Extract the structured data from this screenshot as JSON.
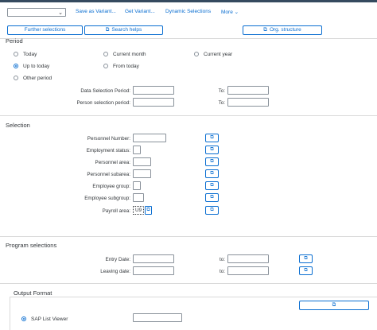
{
  "toolbar": {
    "variant_value": "",
    "save_as_variant": "Save as Variant...",
    "get_variant": "Get Variant...",
    "dynamic_selections": "Dynamic Selections",
    "more": "More"
  },
  "buttons": {
    "further_selections": "Further selections",
    "search_helps": "Search helps",
    "org_structure": "Org. structure"
  },
  "period": {
    "title": "Period",
    "options": [
      "Today",
      "Current month",
      "Current year",
      "Up to today",
      "From today",
      "Other period"
    ],
    "selected": "Up to today",
    "data_selection_label": "Data Selection Period:",
    "person_selection_label": "Person selection period:",
    "to_label": "To:"
  },
  "selection": {
    "title": "Selection",
    "fields": [
      {
        "label": "Personnel Number:",
        "value": ""
      },
      {
        "label": "Employment status:",
        "value": ""
      },
      {
        "label": "Personnel area:",
        "value": ""
      },
      {
        "label": "Personnel subarea:",
        "value": ""
      },
      {
        "label": "Employee group:",
        "value": ""
      },
      {
        "label": "Employee subgroup:",
        "value": ""
      },
      {
        "label": "Payroll area:",
        "value": "U9"
      }
    ]
  },
  "program_selections": {
    "title": "Program selections",
    "entry_date_label": "Entry Date:",
    "leaving_date_label": "Leaving date:",
    "to_label": "to:"
  },
  "output_format": {
    "title": "Output Format",
    "sap_list_viewer": "SAP List Viewer"
  },
  "icons": {
    "multiple_selection": "multiple-selection-icon",
    "dropdown": "chevron-down-icon"
  },
  "colors": {
    "accent": "#0a6ed1",
    "shell": "#354a5f"
  }
}
